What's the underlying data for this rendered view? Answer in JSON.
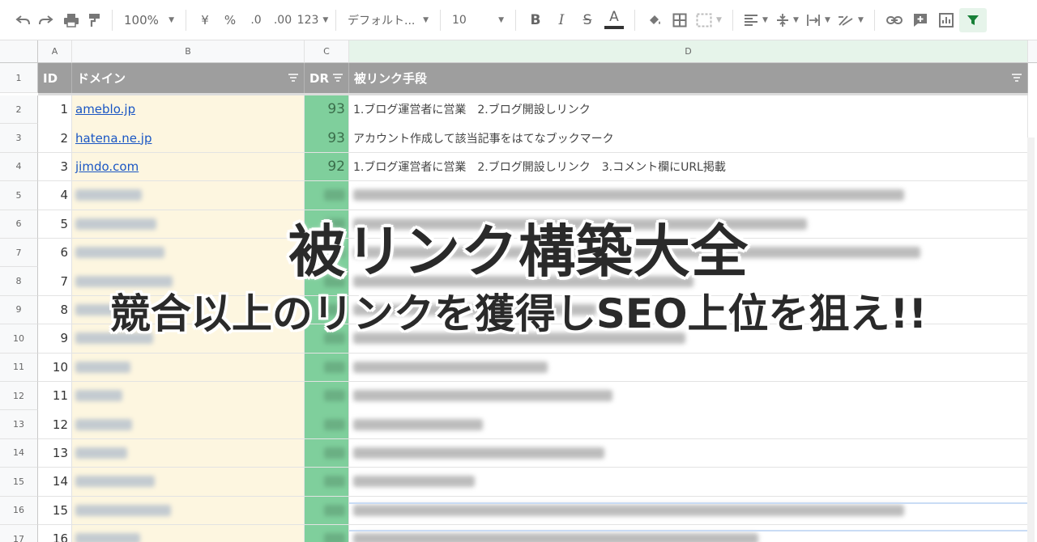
{
  "toolbar": {
    "zoom": "100%",
    "currency": "¥",
    "percent": "%",
    "dec_less": ".0",
    "dec_more": ".00",
    "format_more": "123",
    "font": "デフォルト...",
    "font_size": "10"
  },
  "columns": [
    "A",
    "B",
    "C",
    "D"
  ],
  "header": {
    "id": "ID",
    "domain": "ドメイン",
    "dr": "DR",
    "method": "被リンク手段"
  },
  "rows": [
    {
      "row": "2",
      "id": "1",
      "domain": "ameblo.jp",
      "dr": "93",
      "method": "1.ブログ運営者に営業　2.ブログ開設しリンク"
    },
    {
      "row": "3",
      "id": "2",
      "domain": "hatena.ne.jp",
      "dr": "93",
      "method": "アカウント作成して該当記事をはてなブックマーク"
    },
    {
      "row": "4",
      "id": "3",
      "domain": "jimdo.com",
      "dr": "92",
      "method": "1.ブログ運営者に営業　2.ブログ開設しリンク　3.コメント欄にURL掲載"
    },
    {
      "row": "5",
      "id": "4"
    },
    {
      "row": "6",
      "id": "5"
    },
    {
      "row": "7",
      "id": "6"
    },
    {
      "row": "8",
      "id": "7"
    },
    {
      "row": "9",
      "id": "8"
    },
    {
      "row": "10",
      "id": "9"
    },
    {
      "row": "11",
      "id": "10"
    },
    {
      "row": "12",
      "id": "11"
    },
    {
      "row": "13",
      "id": "12"
    },
    {
      "row": "14",
      "id": "13"
    },
    {
      "row": "15",
      "id": "14"
    },
    {
      "row": "16",
      "id": "15"
    },
    {
      "row": "17",
      "id": "16"
    }
  ],
  "header_row_number": "1",
  "overlay": {
    "title": "被リンク構築大全",
    "subtitle": "競合以上のリンクを獲得しSEO上位を狙え!!"
  },
  "colors": {
    "header_bg": "#9e9e9e",
    "dr_bg": "#7fcf9c",
    "domain_bg": "#fdf6e0",
    "link": "#1a56c4"
  }
}
